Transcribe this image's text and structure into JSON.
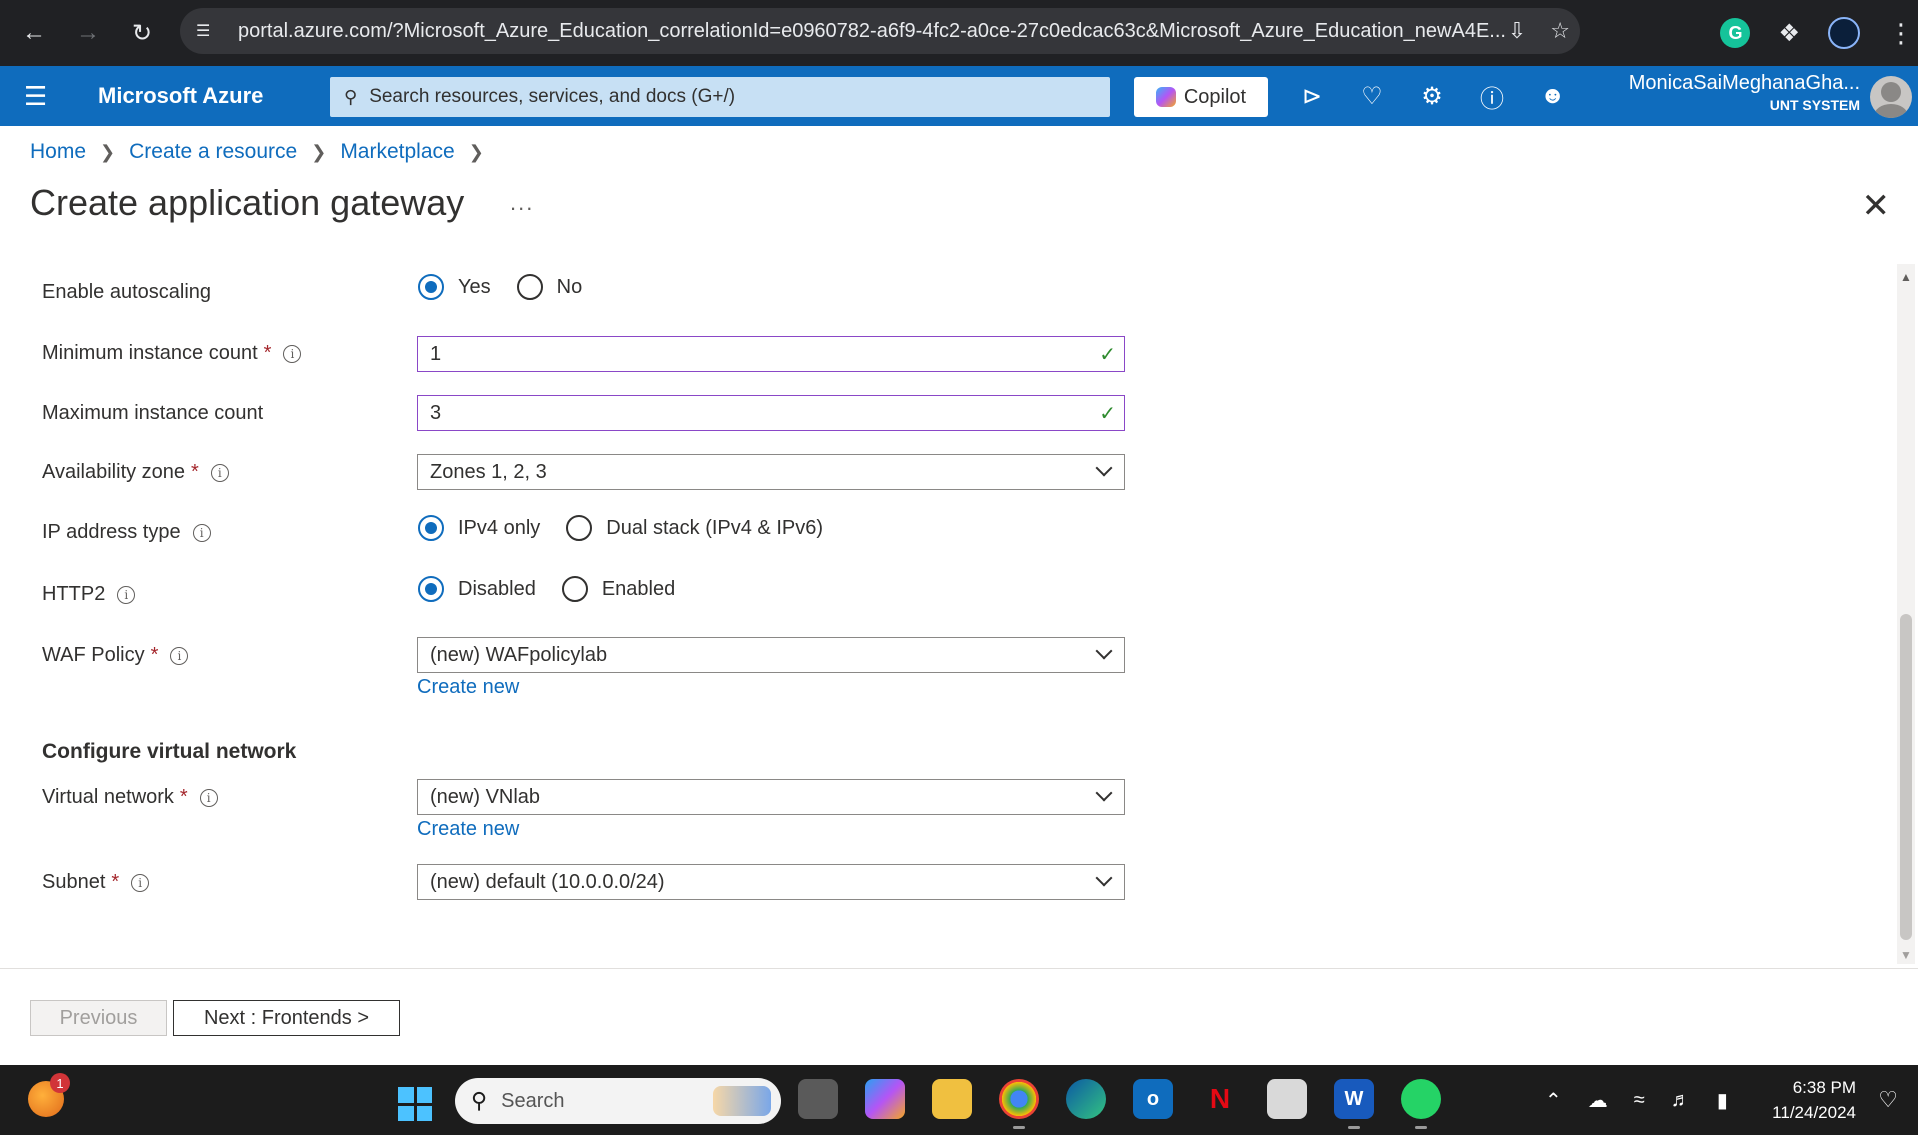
{
  "browser": {
    "url": "portal.azure.com/?Microsoft_Azure_Education_correlationId=e0960782-a6f9-4fc2-a0ce-27c0edcac63c&Microsoft_Azure_Education_newA4E..."
  },
  "azure": {
    "brand": "Microsoft Azure",
    "search_placeholder": "Search resources, services, and docs (G+/)",
    "copilot_label": "Copilot",
    "user_name": "MonicaSaiMeghanaGha...",
    "user_tenant": "UNT SYSTEM"
  },
  "breadcrumb": [
    "Home",
    "Create a resource",
    "Marketplace"
  ],
  "page": {
    "title": "Create application gateway",
    "more": "..."
  },
  "form": {
    "autoscaling": {
      "label": "Enable autoscaling",
      "options": [
        "Yes",
        "No"
      ],
      "selected": "Yes"
    },
    "min_instance": {
      "label": "Minimum instance count",
      "value": "1"
    },
    "max_instance": {
      "label": "Maximum instance count",
      "value": "3"
    },
    "availability_zone": {
      "label": "Availability zone",
      "value": "Zones 1, 2, 3"
    },
    "ip_type": {
      "label": "IP address type",
      "options": [
        "IPv4 only",
        "Dual stack (IPv4 & IPv6)"
      ],
      "selected": "IPv4 only"
    },
    "http2": {
      "label": "HTTP2",
      "options": [
        "Disabled",
        "Enabled"
      ],
      "selected": "Disabled"
    },
    "waf_policy": {
      "label": "WAF Policy",
      "value": "(new) WAFpolicylab",
      "create_new": "Create new"
    },
    "vnet_section": "Configure virtual network",
    "virtual_network": {
      "label": "Virtual network",
      "value": "(new) VNlab",
      "create_new": "Create new"
    },
    "subnet": {
      "label": "Subnet",
      "value": "(new) default (10.0.0.0/24)"
    },
    "required_mark": "*"
  },
  "footer": {
    "previous": "Previous",
    "next": "Next : Frontends >"
  },
  "taskbar": {
    "weather_badge": "1",
    "search_placeholder": "Search",
    "time": "6:38 PM",
    "date": "11/24/2024"
  },
  "colors": {
    "azure_blue": "#0f6cbd",
    "input_focus_border": "#8a47c7",
    "valid_check": "#2e8b2e",
    "required": "#a4262c"
  }
}
